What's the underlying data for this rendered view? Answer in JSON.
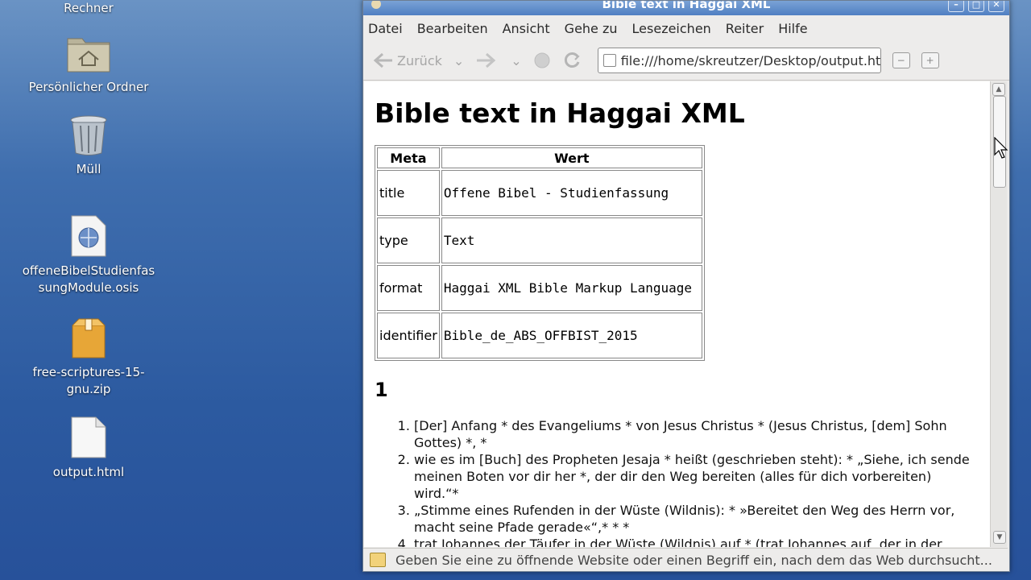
{
  "desktop": {
    "icons": [
      {
        "label": "Rechner"
      },
      {
        "label": "Persönlicher Ordner"
      },
      {
        "label": "Müll"
      },
      {
        "label": "offeneBibelStudienfassungModule.osis"
      },
      {
        "label": "free-scriptures-15-gnu.zip"
      },
      {
        "label": "output.html"
      }
    ]
  },
  "window": {
    "title": "Bible text in Haggai XML",
    "menu": [
      "Datei",
      "Bearbeiten",
      "Ansicht",
      "Gehe zu",
      "Lesezeichen",
      "Reiter",
      "Hilfe"
    ],
    "toolbar": {
      "back_label": "Zurück",
      "url": "file:///home/skreutzer/Desktop/output.ht"
    },
    "status": "Geben Sie eine zu öffnende Website oder einen Begriff ein, nach dem das Web durchsucht..."
  },
  "page": {
    "heading": "Bible text in Haggai XML",
    "table": {
      "headers": [
        "Meta",
        "Wert"
      ],
      "rows": [
        {
          "key": "title",
          "value": "Offene Bibel - Studienfassung"
        },
        {
          "key": "type",
          "value": "Text"
        },
        {
          "key": "format",
          "value": "Haggai XML Bible Markup Language"
        },
        {
          "key": "identifier",
          "value": "Bible_de_ABS_OFFBIST_2015"
        }
      ]
    },
    "chapter": "1",
    "verses": [
      "[Der] Anfang * des Evangeliums * von Jesus Christus * (Jesus Christus, [dem] Sohn Gottes) *, *",
      "wie es im [Buch] des Propheten Jesaja * heißt (geschrieben steht): * „Siehe, ich sende meinen Boten vor dir her *, der dir den Weg bereiten (alles für dich vorbereiten) wird.“*",
      "„Stimme eines Rufenden in der Wüste (Wildnis): * »Bereitet den Weg des Herrn vor, macht seine Pfade gerade«“,* * *",
      "trat Johannes der Täufer in der Wüste (Wildnis) auf * (trat Johannes auf, der in der Wüste"
    ]
  }
}
